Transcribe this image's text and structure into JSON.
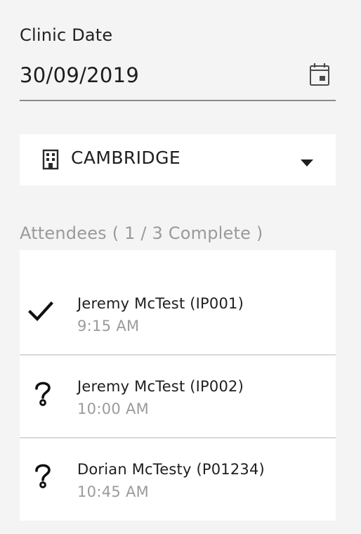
{
  "clinic_date": {
    "label": "Clinic Date",
    "value": "30/09/2019",
    "icon": "calendar-icon"
  },
  "location": {
    "icon": "building-icon",
    "selected": "CAMBRIDGE",
    "dropdown_icon": "caret-down-icon"
  },
  "attendees": {
    "heading": "Attendees ( 1 / 3 Complete )",
    "items": [
      {
        "name": "Jeremy McTest (IP001)",
        "time": "9:15 AM",
        "status": "complete",
        "icon": "checkmark-icon"
      },
      {
        "name": "Jeremy McTest (IP002)",
        "time": "10:00 AM",
        "status": "unknown",
        "icon": "question-icon"
      },
      {
        "name": "Dorian McTesty (P01234)",
        "time": "10:45 AM",
        "status": "unknown",
        "icon": "question-icon"
      }
    ]
  },
  "colors": {
    "background": "#f4f4f4",
    "card": "#ffffff",
    "text_primary": "#202020",
    "text_muted": "#9b9b9b",
    "divider": "#d9d9d9"
  }
}
